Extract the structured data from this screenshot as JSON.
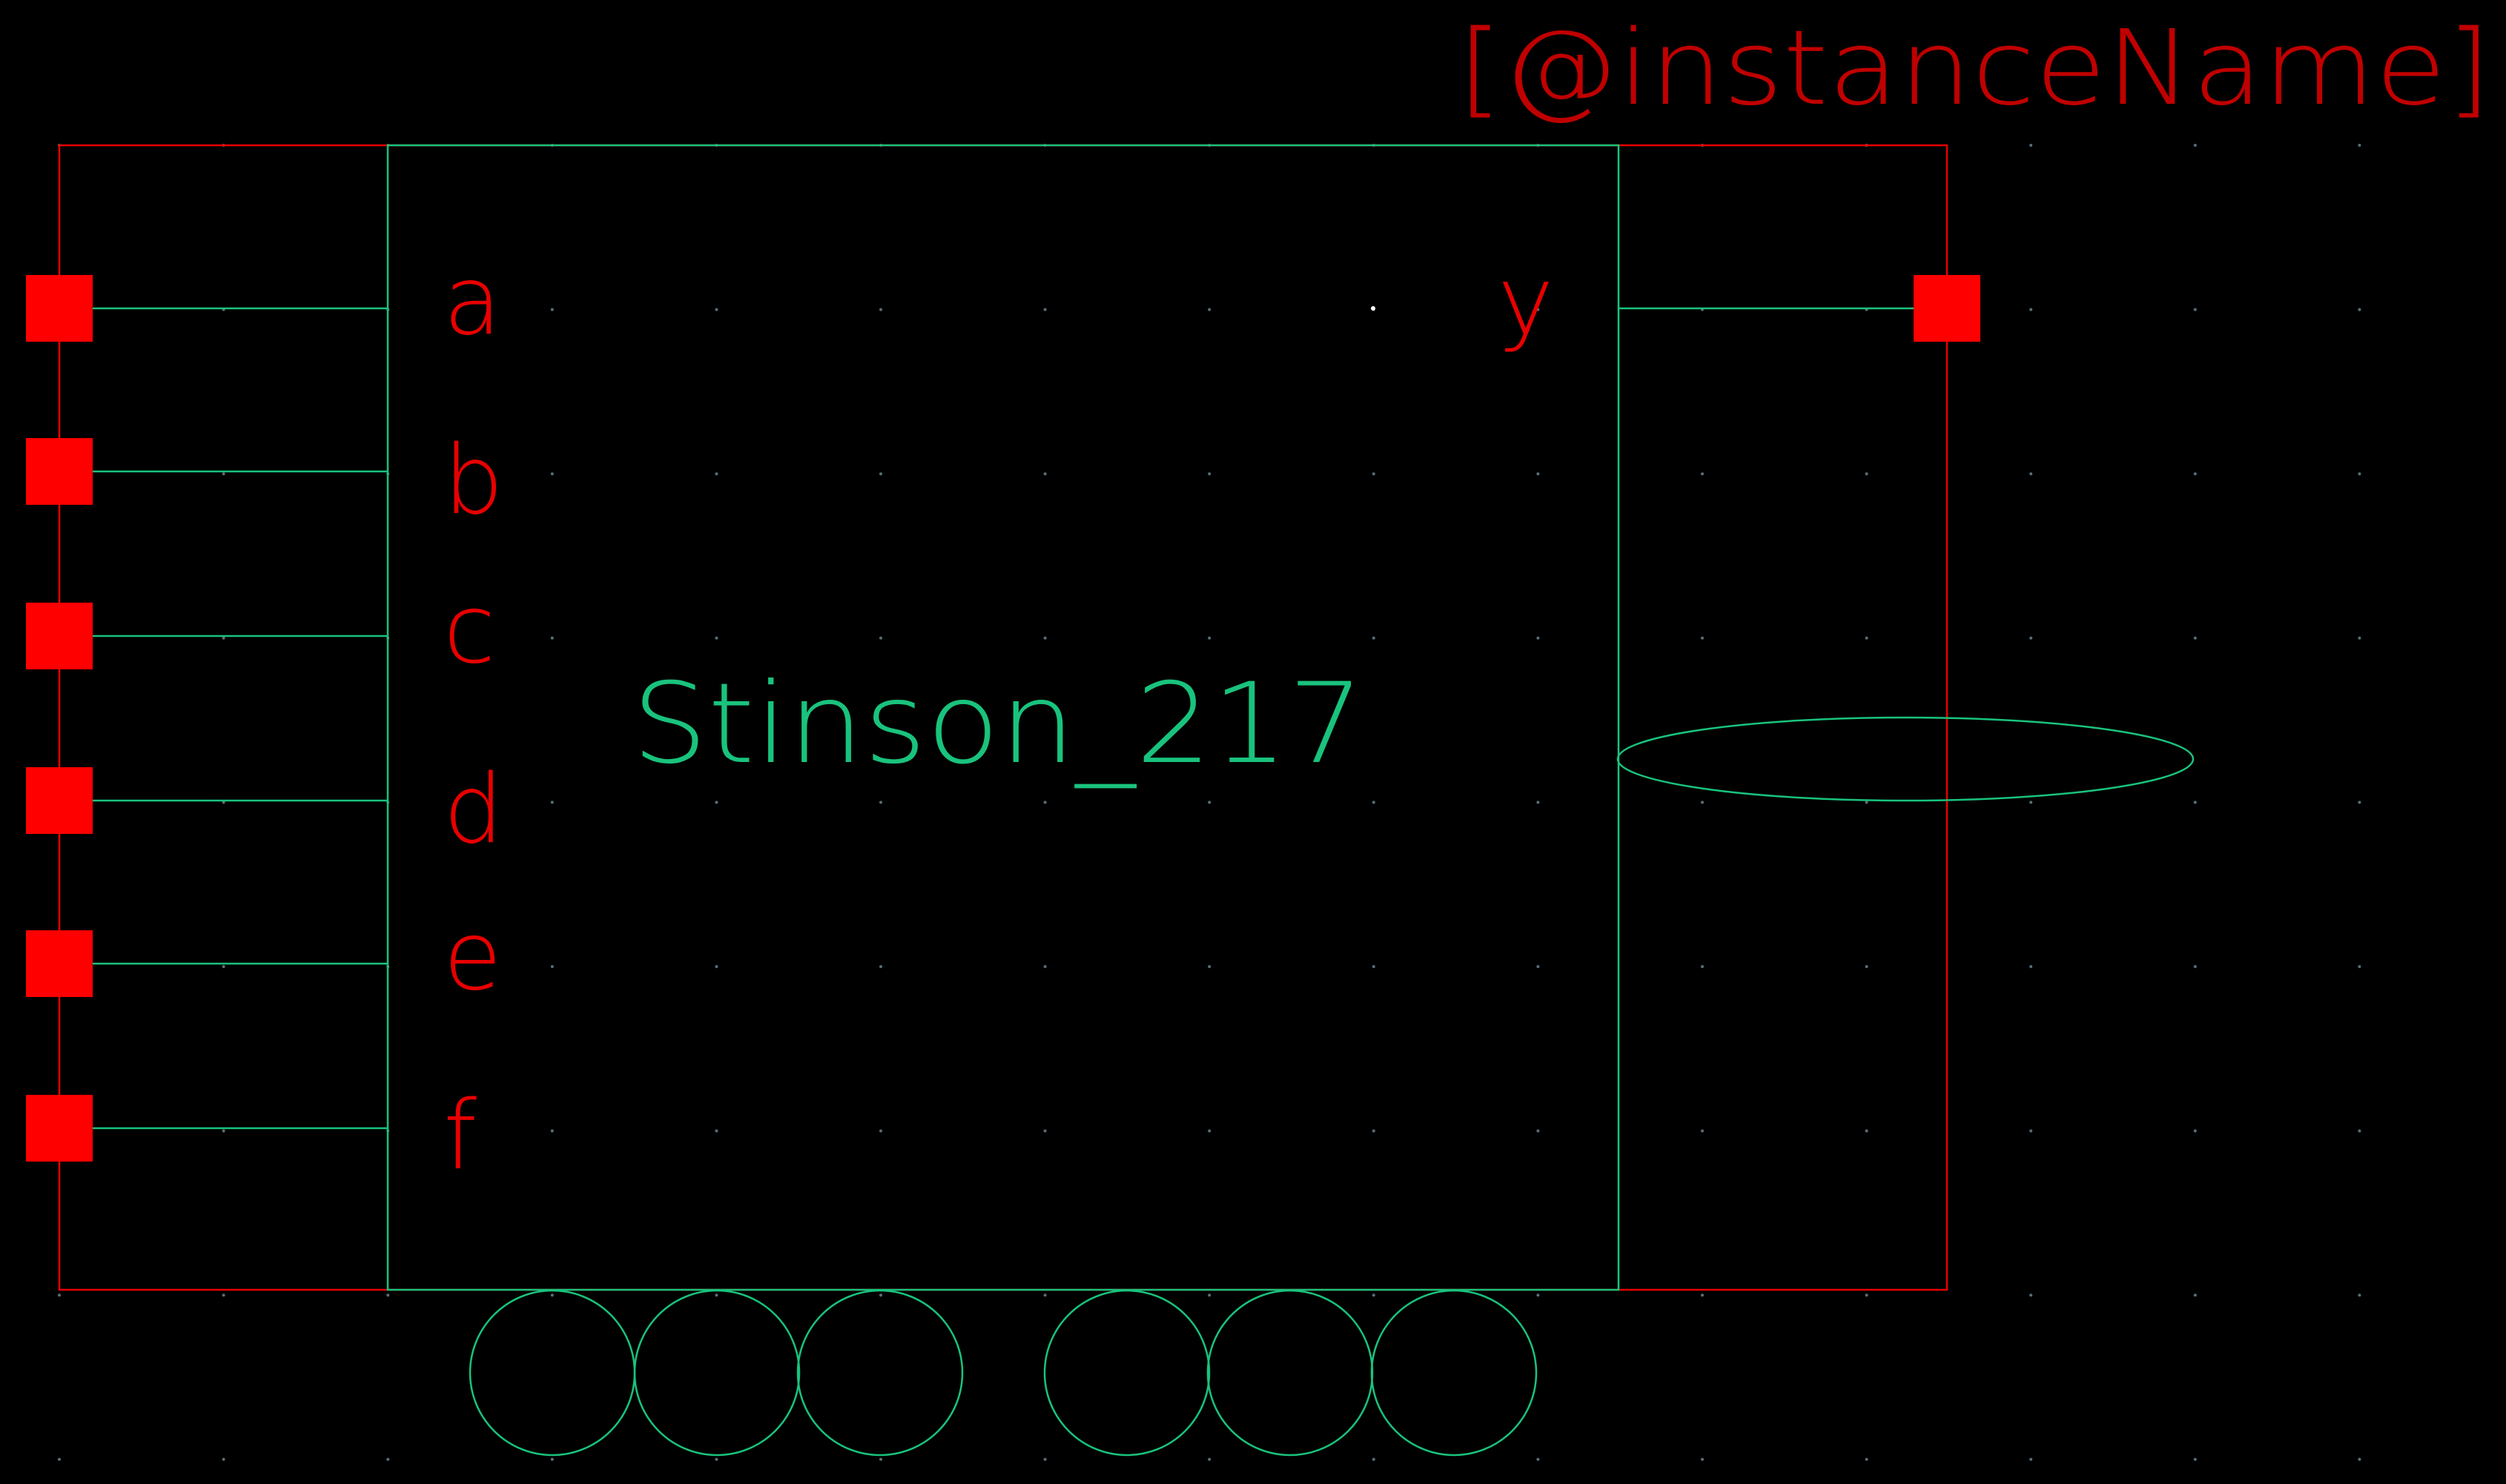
{
  "instance_name_label": "[@instanceName]",
  "cell_name": "Stinson_217",
  "pins": {
    "inputs": [
      "a",
      "b",
      "c",
      "d",
      "e",
      "f"
    ],
    "outputs": [
      "y"
    ]
  },
  "colors": {
    "background": "#000000",
    "grid_dot": "#5a6e78",
    "selection_box": "#e80000",
    "body_outline": "#19c37d",
    "pin_square": "#ff0000",
    "pin_label": "#e80000",
    "cell_label": "#19c37d",
    "instance_label": "#c00000"
  }
}
